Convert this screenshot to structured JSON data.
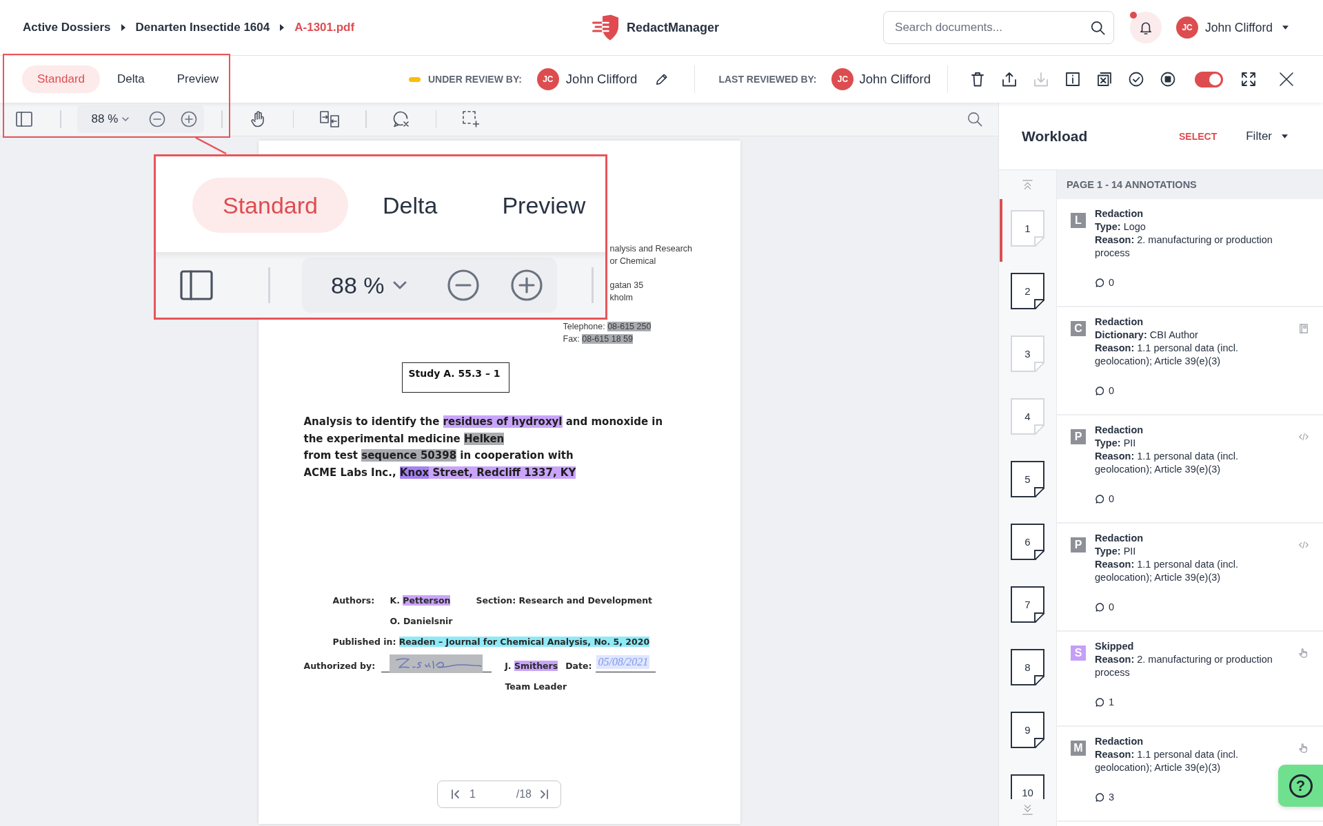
{
  "breadcrumb": [
    {
      "label": "Active Dossiers",
      "current": false
    },
    {
      "label": "Denarten Insectide 1604",
      "current": false
    },
    {
      "label": "A-1301.pdf",
      "current": true
    }
  ],
  "app": {
    "name": "RedactManager"
  },
  "search": {
    "placeholder": "Search documents..."
  },
  "notifications": {
    "unread": true
  },
  "user": {
    "initials": "JC",
    "name": "John Clifford"
  },
  "view_tabs": [
    {
      "label": "Standard",
      "selected": true
    },
    {
      "label": "Delta",
      "selected": false
    },
    {
      "label": "Preview",
      "selected": false
    }
  ],
  "review": {
    "status_label": "UNDER REVIEW BY:",
    "reviewer": {
      "initials": "JC",
      "name": "John Clifford"
    },
    "last_label": "LAST REVIEWED BY:",
    "last_reviewer": {
      "initials": "JC",
      "name": "John Clifford"
    }
  },
  "actions": [
    {
      "disabled": false
    },
    {
      "disabled": false
    },
    {
      "disabled": true
    },
    {
      "disabled": false
    },
    {
      "disabled": false
    },
    {
      "disabled": false
    },
    {
      "disabled": false
    }
  ],
  "redaction_toggle": {
    "on": true
  },
  "toolbar": {
    "zoom": "88 %"
  },
  "callout": {
    "tabs": [
      {
        "label": "Standard",
        "selected": true
      },
      {
        "label": "Delta",
        "selected": false
      },
      {
        "label": "Preview",
        "selected": false
      }
    ],
    "zoom": "88 %"
  },
  "document": {
    "address": [
      [
        "nalysis and Research",
        "or Chemical"
      ],
      [
        "gatan 35",
        "kholm"
      ]
    ],
    "contact": [
      [
        {
          "text": "Telephone: "
        },
        {
          "text": "08-615 250",
          "color": "#a9abb0"
        }
      ],
      [
        {
          "text": "Fax: "
        },
        {
          "text": "08-615 18 59",
          "color": "#a9abb0"
        }
      ]
    ],
    "study": "Study A. 55.3 – 1",
    "title": [
      [
        {
          "text": "Analysis to identify the "
        },
        {
          "text": "residues of hydroxyl",
          "color": "#c9a4fa"
        },
        {
          "text": " and monoxide in"
        }
      ],
      [
        {
          "text": "the experimental medicine "
        },
        {
          "text": "Helken",
          "color": "#a9abb0"
        }
      ],
      [
        {
          "text": "from test "
        },
        {
          "text": "sequence 50398",
          "color": "#a9abb0"
        },
        {
          "text": " in cooperation with"
        }
      ],
      [
        {
          "text": "ACME Labs Inc., "
        },
        {
          "text": "Knox",
          "color": "#a582f0"
        },
        {
          "text": " Street, Redcliff 1337, KY",
          "color": "#c9a4fa"
        }
      ]
    ],
    "authors_label": "Authors:",
    "authors": [
      [
        {
          "text": "K. "
        },
        {
          "text": "Petterson",
          "color": "#c9a4fa"
        }
      ],
      [
        {
          "text": "O. Danielsnir"
        }
      ]
    ],
    "section": "Section: Research and Development",
    "published": [
      {
        "text": "Published in: "
      },
      {
        "text": "Readen – Journal for Chemical Analysis, No. 5, 2020",
        "color": "#8feaf7"
      }
    ],
    "authorized_label": "Authorized by:",
    "signature": {
      "color": "#b9bbbf"
    },
    "signer": [
      {
        "text": "J. "
      },
      {
        "text": "Smithers",
        "color": "#c9a4fa"
      }
    ],
    "date_label": "Date:",
    "date": {
      "text": "05/08/2021",
      "color": "#dfe6ff"
    },
    "role": "Team Leader"
  },
  "pager": {
    "page": "1",
    "total": "/18"
  },
  "workload": {
    "title": "Workload",
    "select": "SELECT",
    "filter": "Filter",
    "page_header": "PAGE 1 - 14 ANNOTATIONS",
    "pages": [
      {
        "label": "1",
        "selected": true,
        "viewed": true
      },
      {
        "label": "2",
        "selected": false,
        "viewed": false
      },
      {
        "label": "3",
        "selected": false,
        "viewed": true
      },
      {
        "label": "4",
        "selected": false,
        "viewed": true
      },
      {
        "label": "5",
        "selected": false,
        "viewed": false
      },
      {
        "label": "6",
        "selected": false,
        "viewed": false
      },
      {
        "label": "7",
        "selected": false,
        "viewed": false
      },
      {
        "label": "8",
        "selected": false,
        "viewed": false
      },
      {
        "label": "9",
        "selected": false,
        "viewed": false
      },
      {
        "label": "10",
        "selected": false,
        "viewed": false
      }
    ],
    "annotations": [
      {
        "kind": "logo",
        "badge": "L",
        "color": "#8e9097",
        "title": "Redaction",
        "details": [
          "**Type:** Logo",
          "**Reason:** 2. manufacturing or production process"
        ],
        "comments": "0"
      },
      {
        "kind": "dictionary",
        "badge": "C",
        "color": "#8e9097",
        "title": "Redaction",
        "details": [
          "**Dictionary:** CBI Author",
          "**Reason:** 1.1 personal data (incl. geolocation); Article 39(e)(3)"
        ],
        "comments": "0"
      },
      {
        "kind": "rule",
        "badge": "P",
        "color": "#8e9097",
        "title": "Redaction",
        "details": [
          "**Type:** PII",
          "**Reason:** 1.1 personal data (incl. geolocation); Article 39(e)(3)"
        ],
        "comments": "0"
      },
      {
        "kind": "rule",
        "badge": "P",
        "color": "#8e9097",
        "title": "Redaction",
        "details": [
          "**Type:** PII",
          "**Reason:** 1.1 personal data (incl. geolocation); Article 39(e)(3)"
        ],
        "comments": "0"
      },
      {
        "kind": "manual",
        "badge": "S",
        "color": "#c59ef8",
        "title": "Skipped",
        "details": [
          "**Reason:** 2. manufacturing or production process"
        ],
        "comments": "1"
      },
      {
        "kind": "manual",
        "badge": "M",
        "color": "#8e9097",
        "title": "Redaction",
        "details": [
          "**Reason:** 1.1 personal data (incl. geolocation); Article 39(e)(3)"
        ],
        "comments": "3"
      }
    ]
  },
  "help": {
    "label": "?"
  }
}
